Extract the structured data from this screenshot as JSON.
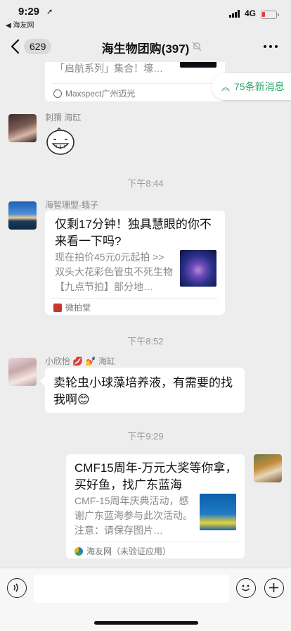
{
  "status_bar": {
    "time": "9:29",
    "back_app": "◀ 海友网",
    "network": "4G"
  },
  "nav": {
    "back_count": "629",
    "title": "海生物团购(397)"
  },
  "new_messages": {
    "label": "75条新消息",
    "color": "#2aa568"
  },
  "messages": [
    {
      "type": "card_partial",
      "desc": "「启航系列」集合！壕…",
      "source": "Maxspect广州迈光"
    },
    {
      "type": "sticker",
      "sender": "刺猬 海缸"
    },
    {
      "type": "time",
      "label": "下午8:44"
    },
    {
      "type": "card",
      "sender": "海智珊盟-蛾子",
      "title": "仅剩17分钟！独具慧眼的你不来看一下吗?",
      "desc": "现在拍价45元0元起拍 >> 双头大花彩色管虫不死生物【九点节拍】部分地…",
      "source": "微拍堂"
    },
    {
      "type": "time",
      "label": "下午8:52"
    },
    {
      "type": "text",
      "sender": "小欣怡 💋 💅 海缸",
      "text": "卖轮虫小球藻培养液，有需要的找我啊😊"
    },
    {
      "type": "time",
      "label": "下午9:29"
    },
    {
      "type": "card_self",
      "title": "CMF15周年-万元大奖等你拿，买好鱼，找广东蓝海",
      "desc": "CMF-15周年庆典活动，感谢广东蓝海参与此次活动。注意：请保存图片…",
      "source": "海友网（未验证应用）"
    }
  ],
  "input": {
    "value": ""
  }
}
